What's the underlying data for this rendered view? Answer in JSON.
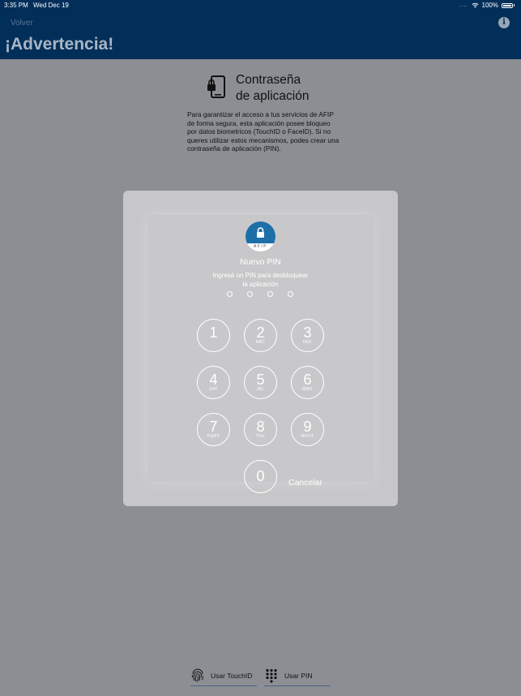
{
  "status_bar": {
    "time": "3:35 PM",
    "date": "Wed Dec 19",
    "signal_dots": "....",
    "battery": "100%"
  },
  "nav": {
    "back": "Volver",
    "title": "¡Advertencia!",
    "info_icon": "i"
  },
  "header": {
    "title_line1": "Contraseña",
    "title_line2": "de aplicación"
  },
  "description": "Para garantizar el acceso a tus servicios de AFIP de forma segura, esta aplicación posee bloqueo por datos biometricos (TouchID o FaceID). Si no queres utilizar estos mecanismos, podes crear una contraseña de aplicación (PIN).",
  "pin": {
    "logo_text": "AFIP",
    "title": "Nuevo PIN",
    "subtitle_line1": "Ingresá un PIN para desbloquear",
    "subtitle_line2": "la aplicación",
    "dots_filled": 0,
    "keys": [
      {
        "n": "1",
        "l": ""
      },
      {
        "n": "2",
        "l": "ABC"
      },
      {
        "n": "3",
        "l": "DEF"
      },
      {
        "n": "4",
        "l": "GHI"
      },
      {
        "n": "5",
        "l": "JKL"
      },
      {
        "n": "6",
        "l": "MNO"
      },
      {
        "n": "7",
        "l": "PQRS"
      },
      {
        "n": "8",
        "l": "TUV"
      },
      {
        "n": "9",
        "l": "WXYZ"
      },
      {
        "n": "0",
        "l": ""
      }
    ],
    "cancel": "Cancelar"
  },
  "bottom": {
    "touchid": "Usar TouchID",
    "pin": "Usar PIN"
  },
  "colors": {
    "nav_bg": "#012f5a",
    "page_bg": "#8c8e93",
    "dialog_bg": "#c7c7c9",
    "logo_blue": "#1d6fa8"
  }
}
